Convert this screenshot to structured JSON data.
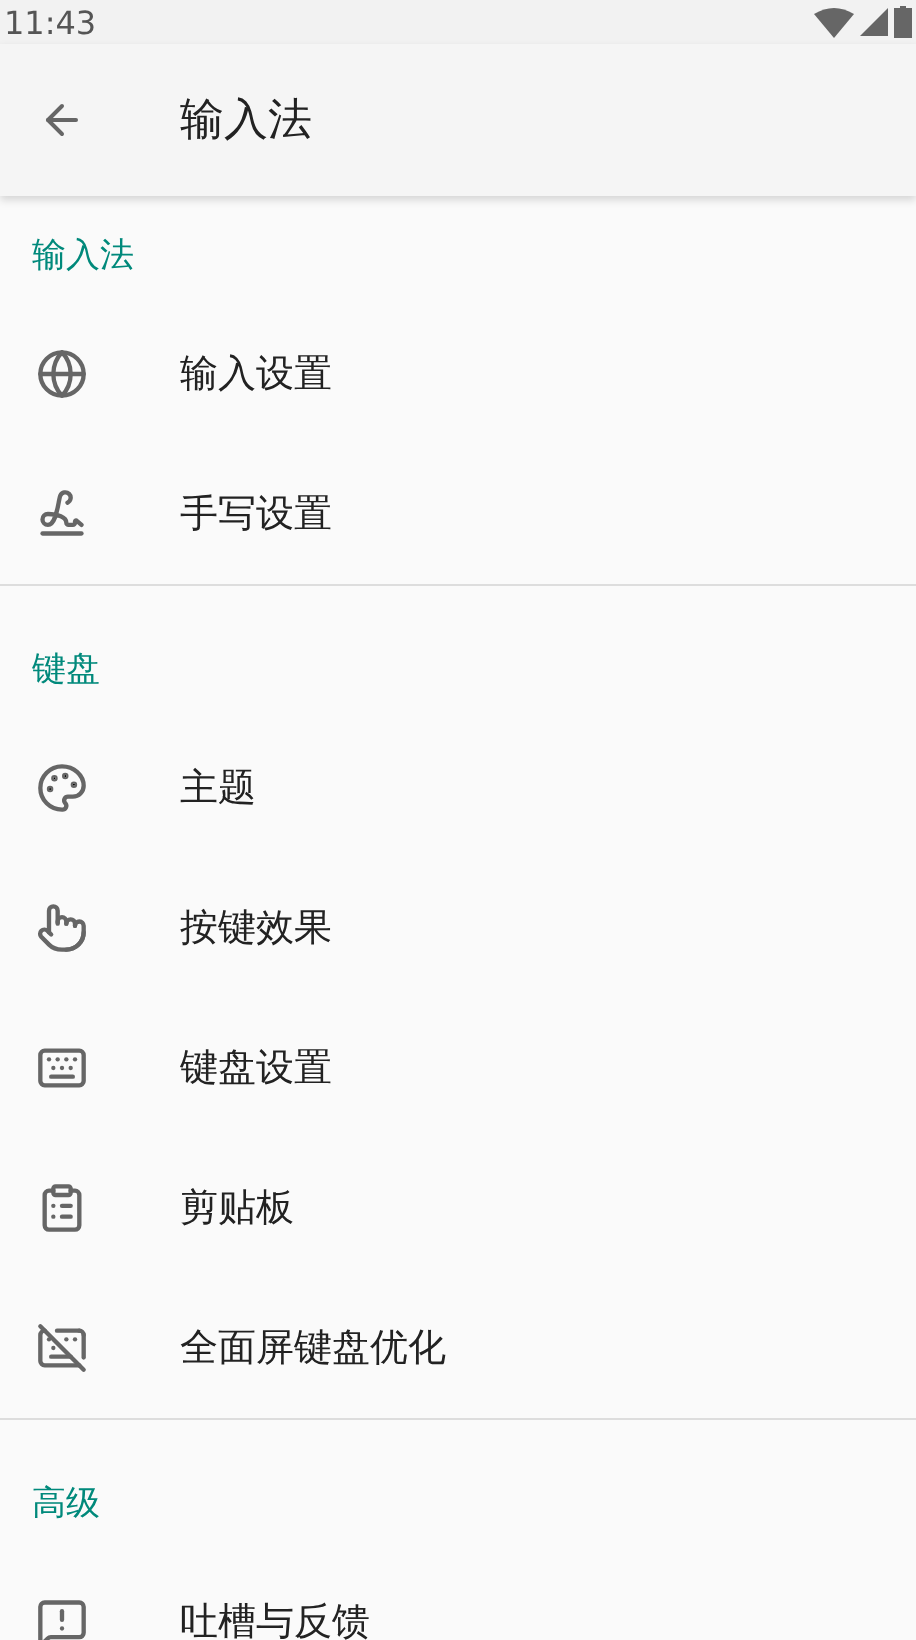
{
  "status_bar": {
    "time": "11:43"
  },
  "app_bar": {
    "title": "输入法"
  },
  "sections": [
    {
      "header": "输入法",
      "items": [
        {
          "label": "输入设置"
        },
        {
          "label": "手写设置"
        }
      ]
    },
    {
      "header": "键盘",
      "items": [
        {
          "label": "主题"
        },
        {
          "label": "按键效果"
        },
        {
          "label": "键盘设置"
        },
        {
          "label": "剪贴板"
        },
        {
          "label": "全面屏键盘优化"
        }
      ]
    },
    {
      "header": "高级",
      "items": [
        {
          "label": "吐槽与反馈"
        }
      ]
    }
  ]
}
